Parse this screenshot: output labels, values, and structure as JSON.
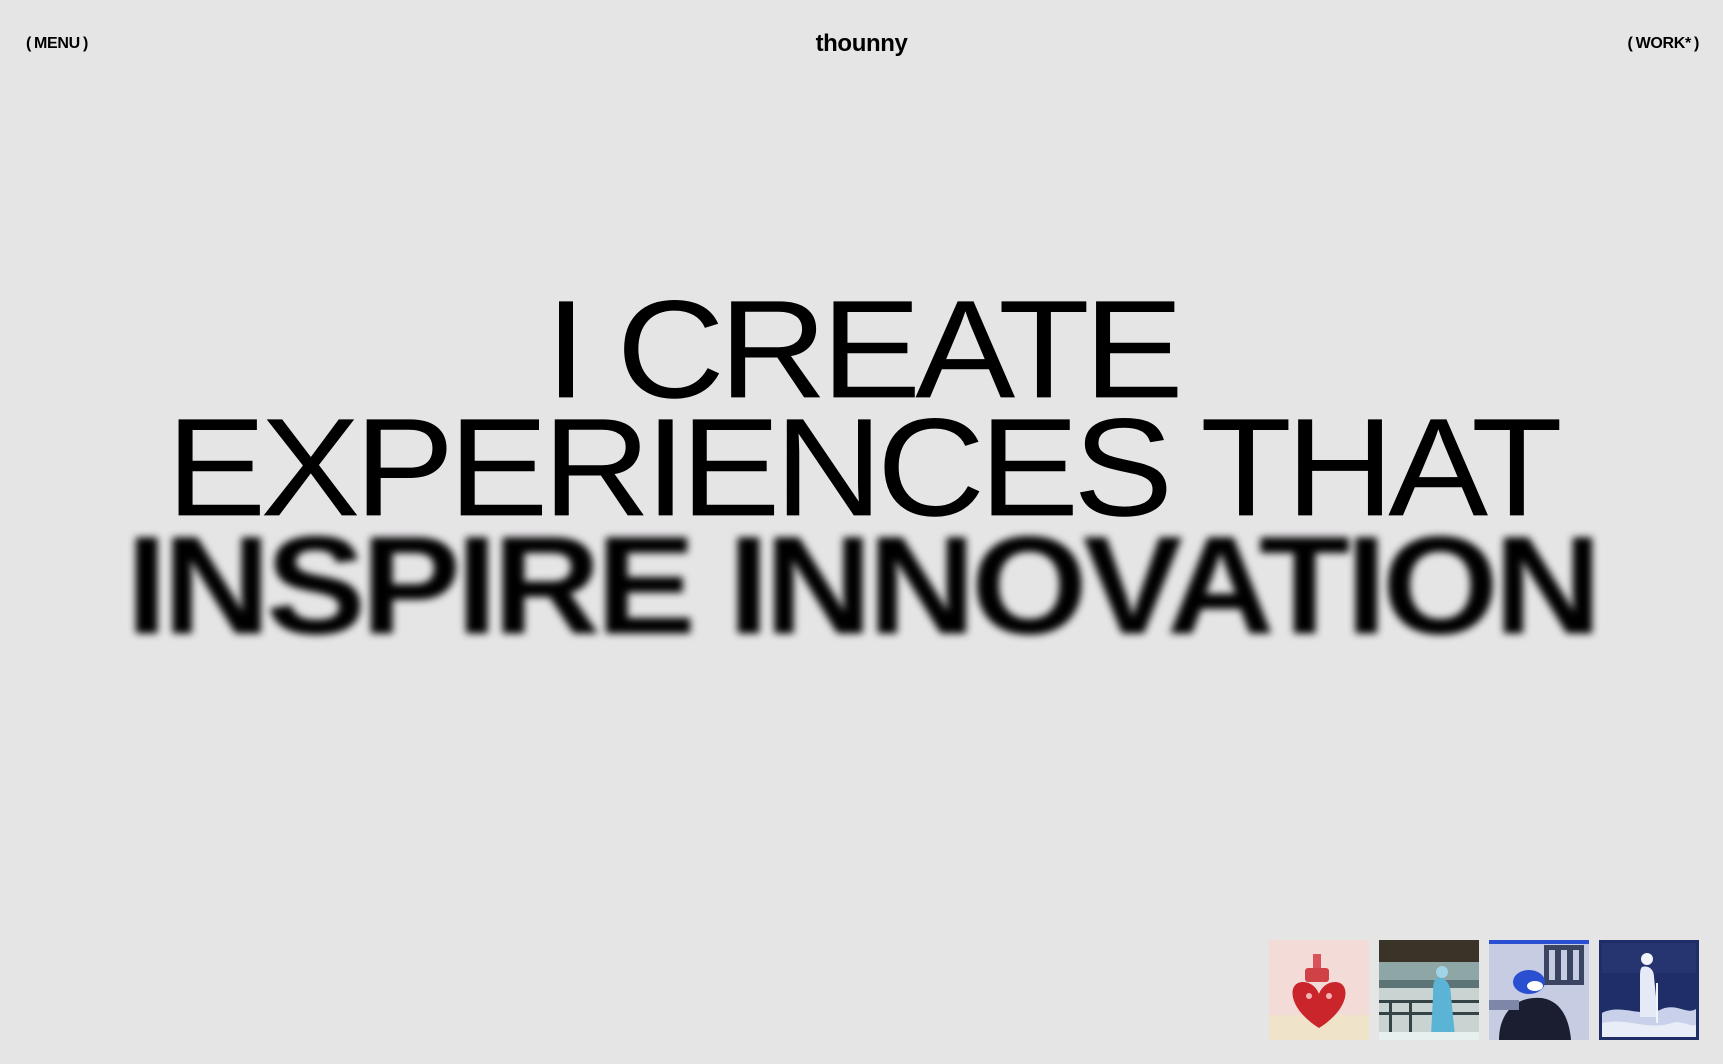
{
  "header": {
    "menu": {
      "open": "(",
      "label": "MENU",
      "close": ")"
    },
    "logo": "thounny",
    "work": {
      "open": "(",
      "label": "WORK*",
      "close": ")"
    }
  },
  "hero": {
    "lines": [
      "I CREATE",
      "EXPERIENCES THAT",
      "INSPIRE INNOVATION"
    ]
  },
  "thumbnails": [
    {
      "subject": "red-heart-vase-image",
      "accent": "#c9252b"
    },
    {
      "subject": "figure-on-railing-image",
      "accent": "#5bb4d6"
    },
    {
      "subject": "figure-with-blue-helmet-image",
      "accent": "#2a4fd0"
    },
    {
      "subject": "standing-figure-night-image",
      "accent": "#1f2e66",
      "active": true
    }
  ],
  "colors": {
    "background": "#e6e5e6",
    "text": "#000000",
    "active_border": "#1f2e66"
  }
}
